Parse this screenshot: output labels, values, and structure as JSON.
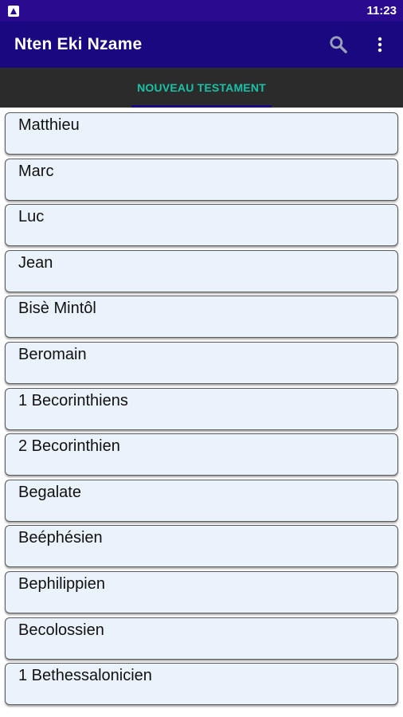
{
  "status_bar": {
    "time": "11:23",
    "notification_icon": "app-notification-icon"
  },
  "app_bar": {
    "title": "Nten Eki Nzame",
    "search_icon": "search-icon",
    "menu_icon": "more-vert-icon"
  },
  "tabs": [
    {
      "label": "NOUVEAU TESTAMENT",
      "selected": true
    }
  ],
  "colors": {
    "status_bar": "#2a0a8f",
    "app_bar": "#1a0880",
    "tab_bar": "#2b2b2b",
    "tab_text": "#19c2a7",
    "item_bg": "#eaf3fb"
  },
  "books": [
    {
      "label": "Matthieu"
    },
    {
      "label": "Marc"
    },
    {
      "label": "Luc"
    },
    {
      "label": "Jean"
    },
    {
      "label": "Bisè Mintôl"
    },
    {
      "label": "Beromain"
    },
    {
      "label": "1 Becorinthiens"
    },
    {
      "label": "2 Becorinthien"
    },
    {
      "label": "Begalate"
    },
    {
      "label": "Beéphésien"
    },
    {
      "label": "Bephilippien"
    },
    {
      "label": "Becolossien"
    },
    {
      "label": "1 Bethessalonicien"
    }
  ]
}
